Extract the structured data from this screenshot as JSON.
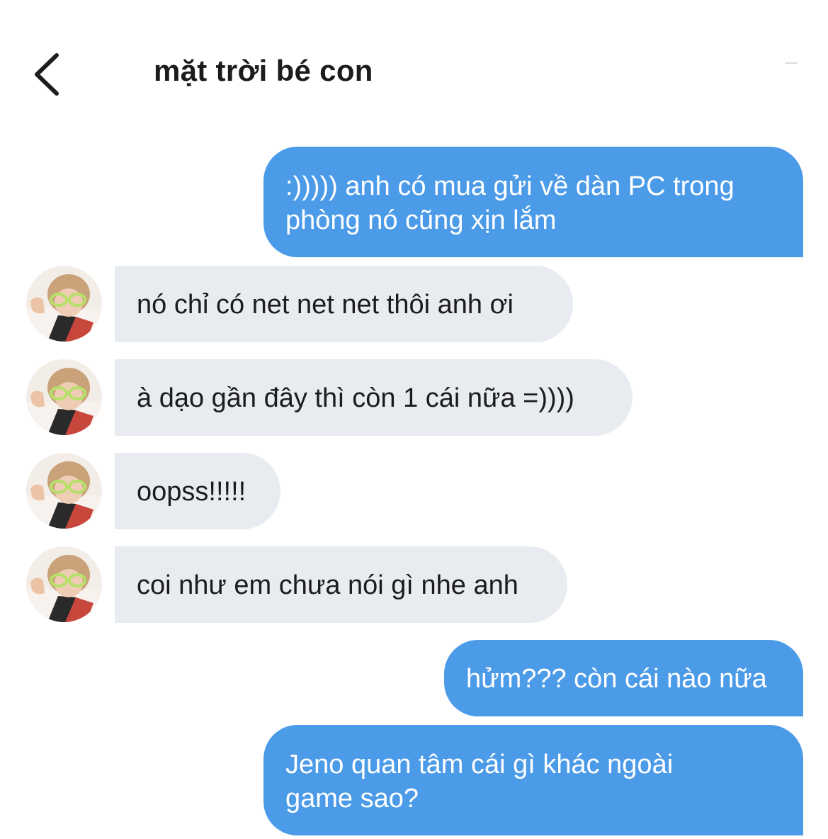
{
  "header": {
    "back_icon": "chevron-left-icon",
    "title": "mặt trời bé con"
  },
  "colors": {
    "outgoing_bubble": "#4c9be8",
    "incoming_bubble": "#e8ebf0",
    "outgoing_text": "#ffffff",
    "incoming_text": "#1c1c1e",
    "background": "#ffffff"
  },
  "messages": [
    {
      "direction": "outgoing",
      "lines": [
        ":))))) anh có mua gửi về dàn PC trong",
        "phòng nó cũng xịn lắm"
      ]
    },
    {
      "direction": "incoming",
      "lines": [
        "nó chỉ có net net net thôi anh ơi"
      ]
    },
    {
      "direction": "incoming",
      "lines": [
        "à dạo gần đây thì còn 1 cái nữa =))))"
      ]
    },
    {
      "direction": "incoming",
      "lines": [
        "oopss!!!!!"
      ]
    },
    {
      "direction": "incoming",
      "lines": [
        "coi như em chưa nói gì nhe anh"
      ]
    },
    {
      "direction": "outgoing",
      "lines": [
        "hửm??? còn cái nào nữa"
      ]
    },
    {
      "direction": "outgoing",
      "lines": [
        "Jeno quan tâm cái gì khác ngoài",
        "game sao?"
      ]
    }
  ]
}
